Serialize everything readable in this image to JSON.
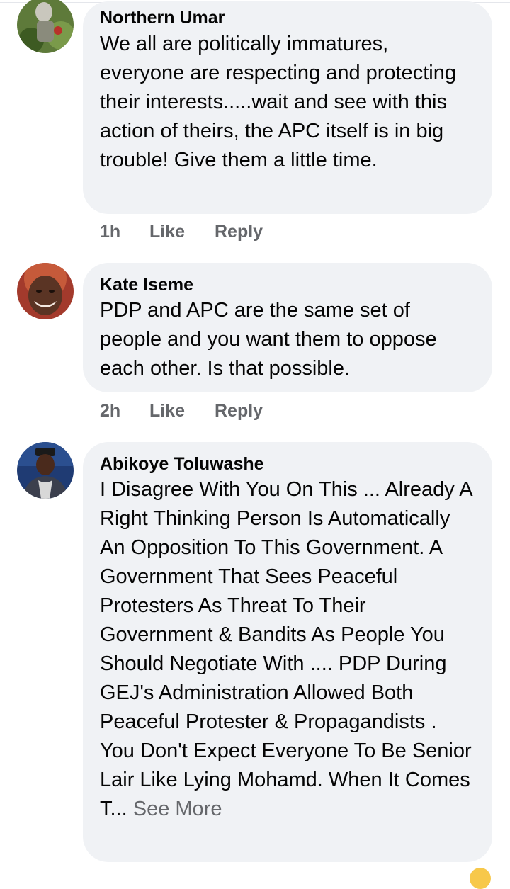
{
  "comments": [
    {
      "author": "Northern Umar",
      "text": "We all are politically immatures, everyone are respecting and protecting their interests.....wait and see with this action of theirs, the APC itself is in big trouble! Give them a little time.",
      "time": "1h",
      "like": "Like",
      "reply": "Reply"
    },
    {
      "author": "Kate Iseme",
      "text": "PDP and APC are the same set of people and you want them to oppose each other. Is that possible.",
      "time": "2h",
      "like": "Like",
      "reply": "Reply"
    },
    {
      "author": "Abikoye Toluwashe",
      "text": "I Disagree With You On This ... Already A Right Thinking Person Is Automatically An Opposition To This Government. A Government That Sees Peaceful Protesters As Threat To Their Government & Bandits As People You Should Negotiate With .... PDP During GEJ's Administration Allowed Both Peaceful Protester & Propagandists . You Don't Expect Everyone To Be Senior Lair Like Lying Mohamd. When It Comes T...",
      "see_more": "See More"
    }
  ],
  "colors": {
    "bubble": "#f0f2f5",
    "text": "#050505",
    "secondary": "#65676b"
  }
}
